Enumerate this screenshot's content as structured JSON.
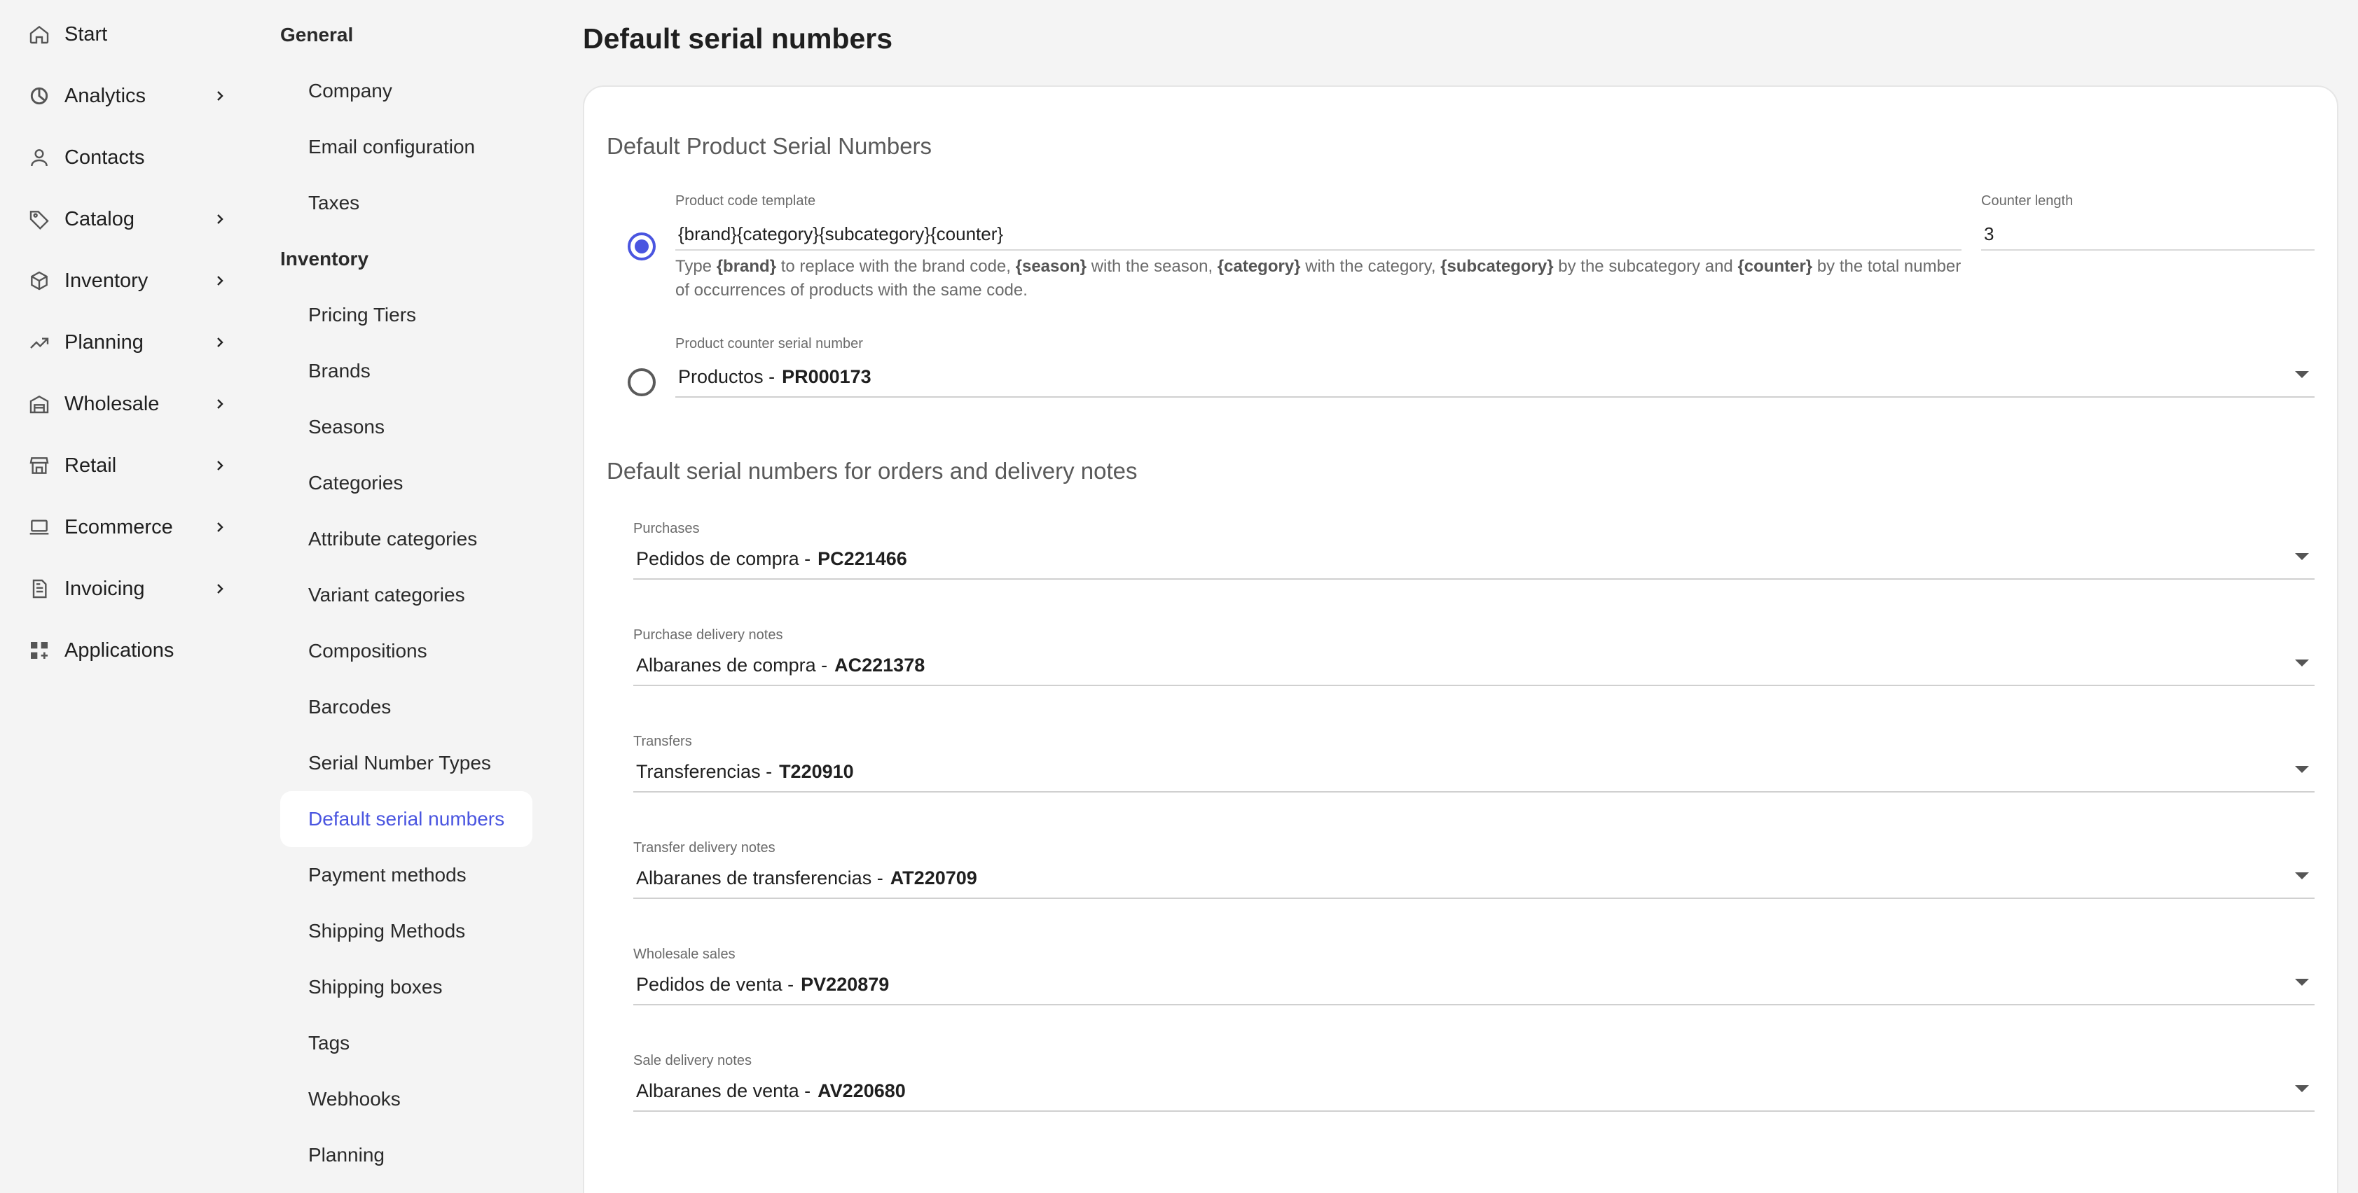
{
  "nav": {
    "items": [
      {
        "label": "Start",
        "icon": "home-icon",
        "chevron": false
      },
      {
        "label": "Analytics",
        "icon": "analytics-icon",
        "chevron": true
      },
      {
        "label": "Contacts",
        "icon": "contacts-icon",
        "chevron": false
      },
      {
        "label": "Catalog",
        "icon": "tag-icon",
        "chevron": true
      },
      {
        "label": "Inventory",
        "icon": "box-icon",
        "chevron": true
      },
      {
        "label": "Planning",
        "icon": "trend-icon",
        "chevron": true
      },
      {
        "label": "Wholesale",
        "icon": "warehouse-icon",
        "chevron": true
      },
      {
        "label": "Retail",
        "icon": "store-icon",
        "chevron": true
      },
      {
        "label": "Ecommerce",
        "icon": "laptop-icon",
        "chevron": true
      },
      {
        "label": "Invoicing",
        "icon": "document-icon",
        "chevron": true
      },
      {
        "label": "Applications",
        "icon": "apps-icon",
        "chevron": false
      }
    ]
  },
  "subnav": {
    "general_heading": "General",
    "general_items": [
      "Company",
      "Email configuration",
      "Taxes"
    ],
    "inventory_heading": "Inventory",
    "inventory_items": [
      "Pricing Tiers",
      "Brands",
      "Seasons",
      "Categories",
      "Attribute categories",
      "Variant categories",
      "Compositions",
      "Barcodes",
      "Serial Number Types",
      "Default serial numbers",
      "Payment methods",
      "Shipping Methods",
      "Shipping boxes",
      "Tags",
      "Webhooks",
      "Planning"
    ],
    "active_item": "Default serial numbers"
  },
  "page": {
    "title": "Default serial numbers"
  },
  "product_section": {
    "title": "Default Product Serial Numbers",
    "template_label": "Product code template",
    "template_value": "{brand}{category}{subcategory}{counter}",
    "counter_label": "Counter length",
    "counter_value": "3",
    "helper": {
      "t1": "Type",
      "brand": "{brand}",
      "t2": "to replace with the brand code,",
      "season": "{season}",
      "t3": "with the season,",
      "category": "{category}",
      "t4": "with the category,",
      "subcategory": "{subcategory}",
      "t5": "by the subcategory and",
      "counter": "{counter}",
      "t6": "by the total number of occurrences of products with the same code."
    },
    "counter_serial_label": "Product counter serial number",
    "counter_serial_name": "Productos -",
    "counter_serial_code": "PR000173",
    "selected_option": "template"
  },
  "orders_section": {
    "title": "Default serial numbers for orders and delivery notes",
    "fields": [
      {
        "label": "Purchases",
        "name": "Pedidos de compra -",
        "code": "PC221466"
      },
      {
        "label": "Purchase delivery notes",
        "name": "Albaranes de compra -",
        "code": "AC221378"
      },
      {
        "label": "Transfers",
        "name": "Transferencias -",
        "code": "T220910"
      },
      {
        "label": "Transfer delivery notes",
        "name": "Albaranes de transferencias -",
        "code": "AT220709"
      },
      {
        "label": "Wholesale sales",
        "name": "Pedidos de venta -",
        "code": "PV220879"
      },
      {
        "label": "Sale delivery notes",
        "name": "Albaranes de venta -",
        "code": "AV220680"
      }
    ]
  },
  "colors": {
    "accent": "#4a55e0",
    "background": "#f4f4f4",
    "card": "#ffffff"
  }
}
